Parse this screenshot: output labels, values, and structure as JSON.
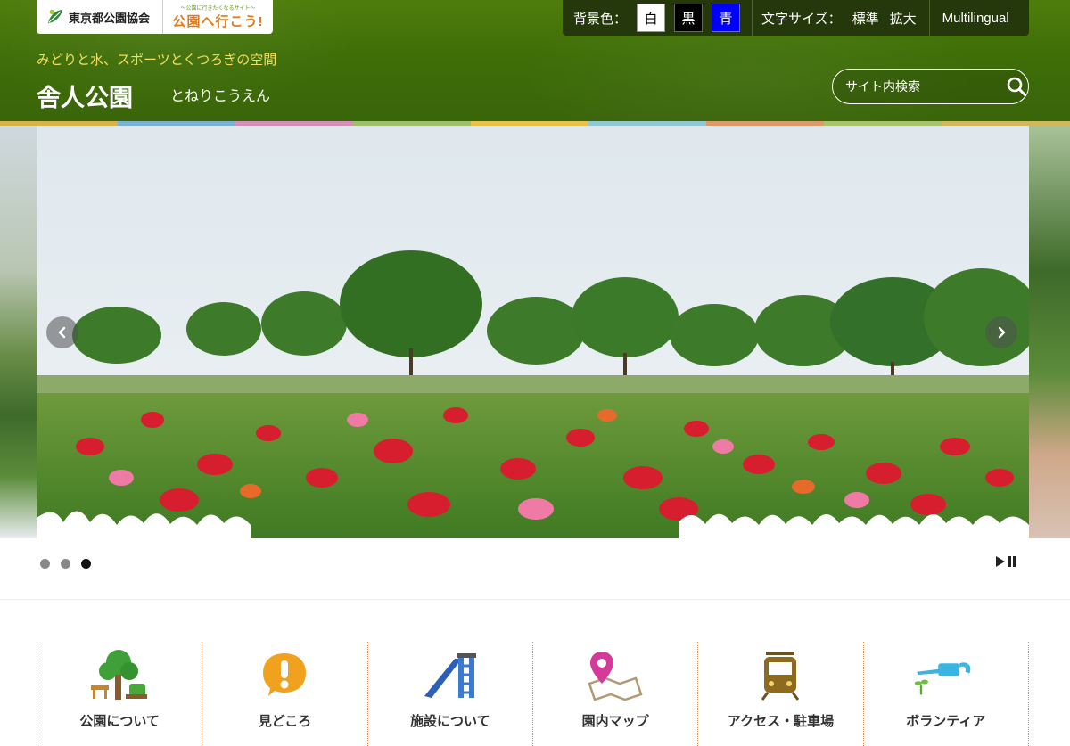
{
  "header": {
    "org_name": "東京都公園協会",
    "site_tagline": "～公園に行きたくなるサイト～",
    "site_name": "公園へ行こう!",
    "tagline": "みどりと水、スポーツとくつろぎの空間",
    "park_name": "舎人公園",
    "park_reading": "とねりこうえん",
    "search": {
      "placeholder": "サイト内検索"
    }
  },
  "utility": {
    "bg_label": "背景色：",
    "bg_white": "白",
    "bg_black": "黒",
    "bg_blue": "青",
    "size_label": "文字サイズ：",
    "size_standard": "標準",
    "size_large": "拡大",
    "multilingual": "Multilingual"
  },
  "slider": {
    "slide_count": 3,
    "active_index": 2
  },
  "nav": {
    "items": [
      {
        "label": "公園について",
        "icon": "tree-bench-icon"
      },
      {
        "label": "見どころ",
        "icon": "exclamation-bubble-icon"
      },
      {
        "label": "施設について",
        "icon": "slide-icon"
      },
      {
        "label": "園内マップ",
        "icon": "map-pin-icon"
      },
      {
        "label": "アクセス・駐車場",
        "icon": "train-icon"
      },
      {
        "label": "ボランティア",
        "icon": "watering-can-icon"
      }
    ]
  },
  "colors": {
    "header_green": "#3f6e08",
    "tagline_yellow": "#f3df5a",
    "util_bar": "#24380c"
  }
}
